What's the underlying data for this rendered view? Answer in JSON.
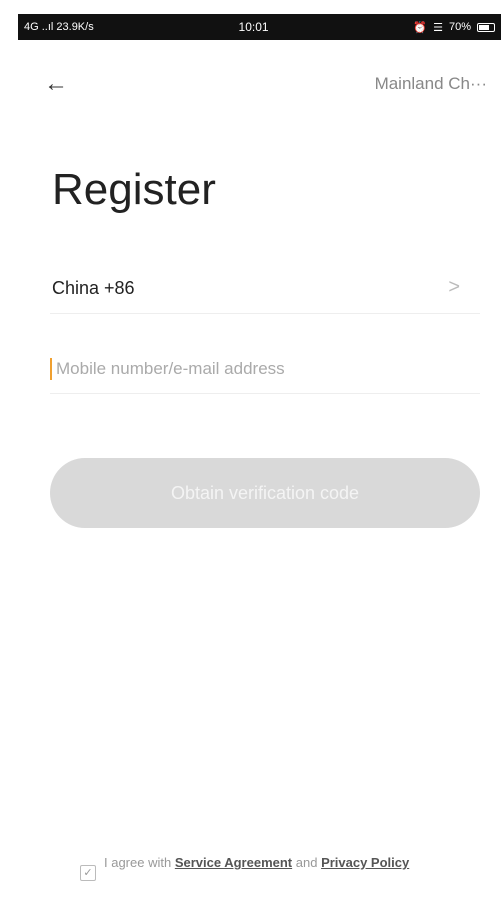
{
  "status_bar": {
    "left": "4G ..ıl  23.9K/s",
    "time": "10:01",
    "right": "70%"
  },
  "nav": {
    "back_icon": "←",
    "region": "Mainland Ch···"
  },
  "page": {
    "title": "Register"
  },
  "country": {
    "label": "China +86",
    "chevron": ">"
  },
  "phone": {
    "placeholder": "Mobile number/e-mail address",
    "value": ""
  },
  "primary_button": {
    "label": "Obtain verification code"
  },
  "agreement": {
    "checkbox_mark": "✓",
    "prefix": "I agree with ",
    "service_link": "Service Agreement",
    "connector": " and ",
    "privacy_link": "Privacy Policy"
  },
  "colors": {
    "accent": "#f0a030",
    "button_bg": "#d9d9d9"
  }
}
